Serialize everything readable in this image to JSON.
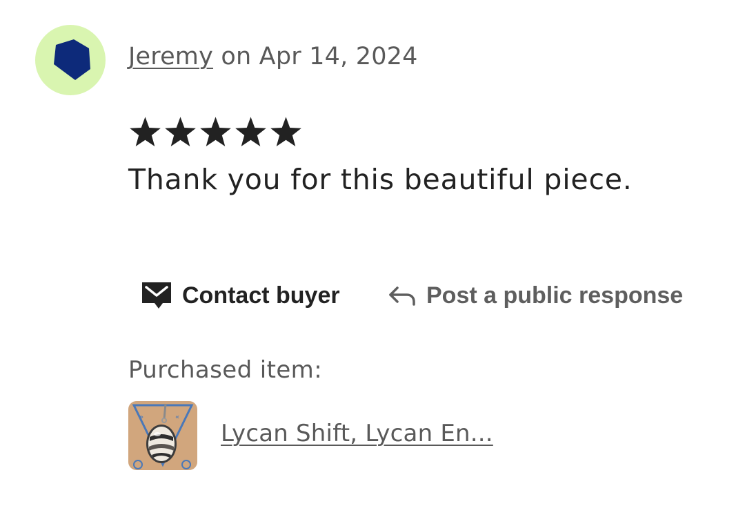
{
  "review": {
    "reviewer_name": "Jeremy",
    "date_text": " on Apr 14, 2024",
    "rating": 5,
    "rating_max": 5,
    "text": "Thank you for this beautiful piece.",
    "avatar": {
      "icon": "pentagon-icon",
      "background_color": "#d9f5b0",
      "shape_color": "#0d2a7a"
    }
  },
  "actions": {
    "contact_label": "Contact buyer",
    "contact_icon": "mail-icon",
    "respond_label": "Post a public response",
    "respond_icon": "reply-arrow-icon"
  },
  "purchase": {
    "label": "Purchased item:",
    "item_title": "Lycan Shift, Lycan En..."
  },
  "colors": {
    "text_primary": "#222222",
    "text_secondary": "#595959"
  }
}
